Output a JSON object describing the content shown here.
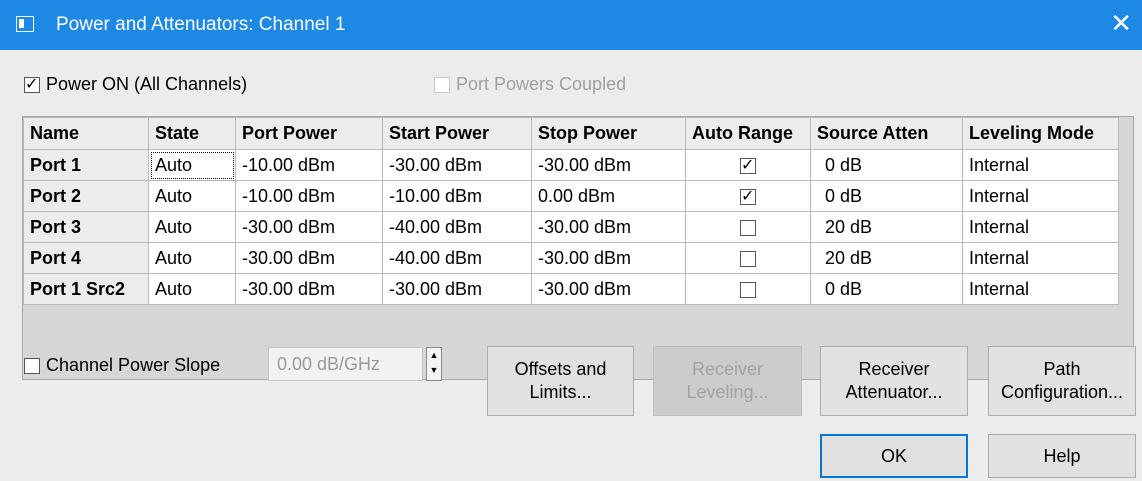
{
  "window": {
    "title": "Power and Attenuators: Channel 1",
    "close_glyph": "✕"
  },
  "power_on": {
    "label": "Power ON (All Channels)",
    "checked": true
  },
  "port_powers_coupled": {
    "label": "Port Powers Coupled",
    "checked": false,
    "enabled": false
  },
  "table": {
    "headers": [
      "Name",
      "State",
      "Port Power",
      "Start Power",
      "Stop Power",
      "Auto Range",
      "Source Atten",
      "Leveling Mode"
    ],
    "rows": [
      {
        "name": "Port 1",
        "state": "Auto",
        "port_power": "-10.00 dBm",
        "start_power": "-30.00 dBm",
        "stop_power": "-30.00 dBm",
        "auto_range": true,
        "source_atten": "0 dB",
        "leveling_mode": "Internal"
      },
      {
        "name": "Port 2",
        "state": "Auto",
        "port_power": "-10.00 dBm",
        "start_power": "-10.00 dBm",
        "stop_power": "0.00 dBm",
        "auto_range": true,
        "source_atten": "0 dB",
        "leveling_mode": "Internal"
      },
      {
        "name": "Port 3",
        "state": "Auto",
        "port_power": "-30.00 dBm",
        "start_power": "-40.00 dBm",
        "stop_power": "-30.00 dBm",
        "auto_range": false,
        "source_atten": "20 dB",
        "leveling_mode": "Internal"
      },
      {
        "name": "Port 4",
        "state": "Auto",
        "port_power": "-30.00 dBm",
        "start_power": "-40.00 dBm",
        "stop_power": "-30.00 dBm",
        "auto_range": false,
        "source_atten": "20 dB",
        "leveling_mode": "Internal"
      },
      {
        "name": "Port 1 Src2",
        "state": "Auto",
        "port_power": "-30.00 dBm",
        "start_power": "-30.00 dBm",
        "stop_power": "-30.00 dBm",
        "auto_range": false,
        "source_atten": "0 dB",
        "leveling_mode": "Internal"
      }
    ]
  },
  "channel_power_slope": {
    "label": "Channel Power Slope",
    "checked": false,
    "value": "0.00 dB/GHz"
  },
  "buttons": {
    "offsets_limits": {
      "line1": "Offsets and",
      "line2": "Limits..."
    },
    "receiver_leveling": {
      "line1": "Receiver",
      "line2": "Leveling...",
      "enabled": false
    },
    "receiver_attenuator": {
      "line1": "Receiver",
      "line2": "Attenuator..."
    },
    "path_configuration": {
      "line1": "Path",
      "line2": "Configuration..."
    },
    "ok": "OK",
    "help": "Help"
  },
  "colors": {
    "titlebar": "#1e88e5",
    "dialog_bg": "#ececec",
    "focus_border": "#0078d7"
  }
}
